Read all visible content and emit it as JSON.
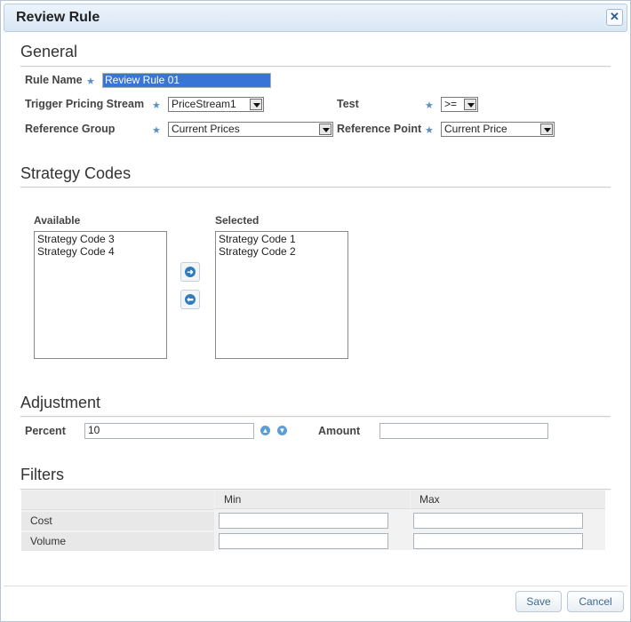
{
  "dialog": {
    "title": "Review Rule"
  },
  "general": {
    "heading": "General",
    "rule_name": {
      "label": "Rule Name",
      "value": "Review Rule 01"
    },
    "trigger_pricing_stream": {
      "label": "Trigger Pricing Stream",
      "value": "PriceStream1"
    },
    "test": {
      "label": "Test",
      "value": ">="
    },
    "reference_group": {
      "label": "Reference Group",
      "value": "Current Prices"
    },
    "reference_point": {
      "label": "Reference Point",
      "value": "Current Price"
    }
  },
  "strategy_codes": {
    "heading": "Strategy Codes",
    "available_label": "Available",
    "selected_label": "Selected",
    "available": [
      "Strategy Code 3",
      "Strategy Code 4"
    ],
    "selected": [
      "Strategy Code 1",
      "Strategy Code 2"
    ]
  },
  "adjustment": {
    "heading": "Adjustment",
    "percent": {
      "label": "Percent",
      "value": "10"
    },
    "amount": {
      "label": "Amount",
      "value": ""
    }
  },
  "filters": {
    "heading": "Filters",
    "columns": [
      "",
      "Min",
      "Max"
    ],
    "rows": [
      {
        "label": "Cost",
        "min": "",
        "max": ""
      },
      {
        "label": "Volume",
        "min": "",
        "max": ""
      }
    ]
  },
  "footer": {
    "save_label": "Save",
    "cancel_label": "Cancel"
  },
  "colors": {
    "accent": "#2f7bbd",
    "title_bg": "#dce9f6",
    "selection": "#3875d7"
  },
  "icons": {
    "close": "close-icon",
    "move_right": "arrow-right-icon",
    "move_left": "arrow-left-icon",
    "increment": "arrow-up-icon",
    "decrement": "arrow-down-icon",
    "required": "star-icon"
  }
}
